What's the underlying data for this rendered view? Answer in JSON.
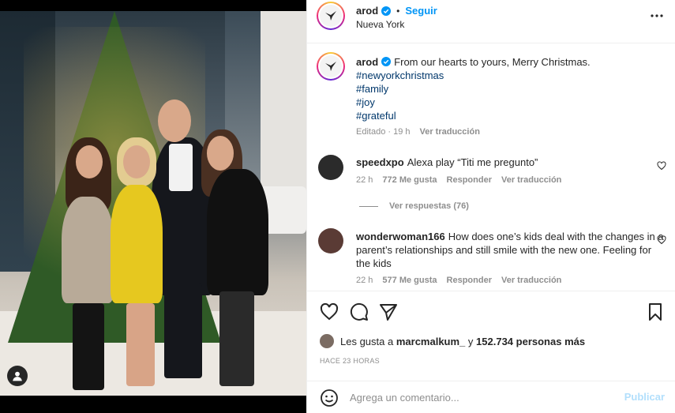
{
  "colors": {
    "accent": "#0095f6",
    "hashtag": "#00376b",
    "muted": "#8e8e8e",
    "publish_disabled": "#b2dffc"
  },
  "post": {
    "header": {
      "username": "arod",
      "separator": "•",
      "follow_label": "Seguir",
      "location": "Nueva York",
      "more_icon": "more-horizontal-icon"
    },
    "caption": {
      "username": "arod",
      "text": "From our hearts to yours, Merry Christmas.",
      "hashtags": [
        "#newyorkchristmas",
        "#family",
        "#joy",
        "#grateful"
      ],
      "edited": "Editado · 19 h",
      "translate": "Ver traducción"
    },
    "comments": [
      {
        "username": "speedxpo",
        "text": "Alexa play “Titi me pregunto”",
        "time": "22 h",
        "likes": "772 Me gusta",
        "reply": "Responder",
        "translate": "Ver traducción",
        "view_replies": "Ver respuestas (76)"
      },
      {
        "username": "wonderwoman166",
        "text": "How does one’s kids deal with the changes in a parent’s relationships and still smile with the new one. Feeling for the kids",
        "time": "22 h",
        "likes": "577 Me gusta",
        "reply": "Responder",
        "translate": "Ver traducción"
      }
    ],
    "likes_line": {
      "prefix": "Les gusta a",
      "user": "marcmalkum_",
      "middle": "y",
      "count": "152.734 personas más"
    },
    "timestamp": "HACE 23 HORAS",
    "add_comment": {
      "placeholder": "Agrega un comentario...",
      "publish_label": "Publicar"
    }
  }
}
